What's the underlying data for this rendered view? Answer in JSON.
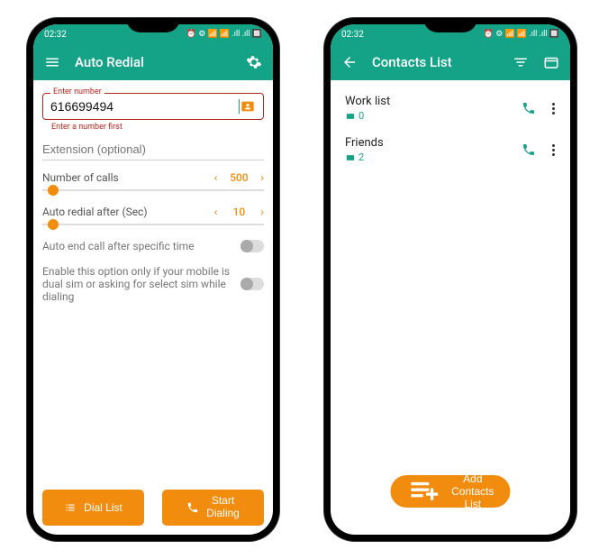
{
  "status": {
    "time": "02:32",
    "indicators": "⏰ ⚙ 📶 📶 .ıll .ıll 🔲"
  },
  "screen1": {
    "title": "Auto Redial",
    "enter_label": "Enter number",
    "phone_value": "616699494",
    "error_text": "Enter a number first",
    "extension_placeholder": "Extension (optional)",
    "num_calls_label": "Number of calls",
    "num_calls_value": "500",
    "redial_label": "Auto redial after (Sec)",
    "redial_value": "10",
    "auto_end_label": "Auto end call after specific time",
    "dual_sim_label": "Enable this option only if your mobile is dual sim or asking for select sim while dialing",
    "dial_list_btn": "Dial List",
    "start_btn_line1": "Start",
    "start_btn_line2": "Dialing"
  },
  "screen2": {
    "title": "Contacts List",
    "items": [
      {
        "name": "Work list",
        "count": "0"
      },
      {
        "name": "Friends",
        "count": "2"
      }
    ],
    "fab_label": "Add Contacts List"
  }
}
